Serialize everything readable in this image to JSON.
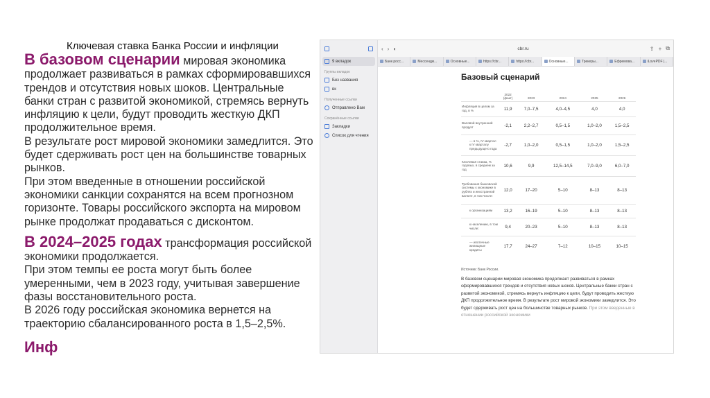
{
  "slide": {
    "title": "Ключевая ставка Банка России и инфляции"
  },
  "left": {
    "p1_lead": "В базовом сценарии",
    "p1_text": " мировая экономика продолжает развиваться в рамках сформировавшихся трендов и отсутствия новых шоков. Центральные банки стран с развитой экономикой, стремясь вернуть инфляцию к цели, будут проводить жесткую ДКП продолжительное время.",
    "p2": "В результате рост мировой экономики замедлится. Это будет сдерживать рост цен на большинстве товарных рынков.",
    "p3": "При этом введенные в отношении российской экономики санкции сохранятся на всем прогнозном горизонте. Товары российского экспорта на мировом рынке продолжат продаваться с дисконтом.",
    "p4_lead": "В 2024–2025 годах",
    "p4_text": " трансформация российской экономики продолжается.",
    "p5": "При этом темпы ее роста могут быть более умеренными, чем в 2023 году, учитывая завершение фазы восстановительного роста.",
    "p6": "В 2026 году российская экономика вернется на траекторию сбалансированного роста в 1,5–2,5%.",
    "cut": "Инф"
  },
  "browser": {
    "sidebar": {
      "tabs_item": "9 вкладок",
      "groups_label": "Группы вкладок",
      "untitled": "Без названия",
      "vk": "вк",
      "shared_label": "Полученные ссылки",
      "sent_to_you": "Отправлено Вам",
      "saved_label": "Сохранённые ссылки",
      "bookmarks": "Закладки",
      "reading_list": "Список для чтения"
    },
    "url": "cbr.ru",
    "tabs": [
      "Банк росс...",
      "Мессендж...",
      "Основные...",
      "https://cbr...",
      "https://cbr...",
      "Основные...",
      "Трекеры...",
      "Ефремова...",
      "iLovePDF |..."
    ],
    "page": {
      "heading": "Базовый сценарий",
      "columns": [
        "2022\n(факт)",
        "2023",
        "2024",
        "2025",
        "2026"
      ],
      "rows": [
        {
          "label": "Инфляция в целом за год, в %",
          "values": [
            "11,9",
            "7,0–7,5",
            "4,0–4,5",
            "4,0",
            "4,0"
          ]
        },
        {
          "label": "Валовой внутренний продукт",
          "values": [
            "-2,1",
            "2,2–2,7",
            "0,5–1,5",
            "1,0–2,0",
            "1,5–2,5"
          ]
        },
        {
          "label": "— в %, IV квартал к IV кварталу предыдущего года",
          "values": [
            "-2,7",
            "1,0–2,0",
            "0,5–1,5",
            "1,0–2,0",
            "1,5–2,5"
          ]
        },
        {
          "label": "Ключевая ставка, % годовых, в среднем за год",
          "values": [
            "10,6",
            "9,9",
            "12,5–14,5",
            "7,0–9,0",
            "6,0–7,0"
          ]
        },
        {
          "label": "Требования банковской системы к экономике в рублях и иностранной валюте, в том числе:",
          "values": [
            "12,0",
            "17–20",
            "5–10",
            "8–13",
            "8–13"
          ]
        },
        {
          "label": "к организациям",
          "values": [
            "13,2",
            "16–19",
            "5–10",
            "8–13",
            "8–13"
          ]
        },
        {
          "label": "к населению, в том числе:",
          "values": [
            "9,4",
            "20–23",
            "5–10",
            "8–13",
            "8–13"
          ]
        },
        {
          "label": "— ипотечные жилищные кредиты",
          "values": [
            "17,7",
            "24–27",
            "7–12",
            "10–15",
            "10–15"
          ]
        }
      ],
      "source": "Источник: Банк России.",
      "body": "В базовом сценарии мировая экономика продолжает развиваться в рамках сформировавшихся трендов и отсутствия новых шоков. Центральные банки стран с развитой экономикой, стремясь вернуть инфляцию к цели, будут проводить жесткую ДКП продолжительное время. В результате рост мировой экономики замедлится. Это будет сдерживать рост цен на большинстве товарных рынков.",
      "body_faded": "При этом введенные в отношении российской экономики"
    }
  }
}
